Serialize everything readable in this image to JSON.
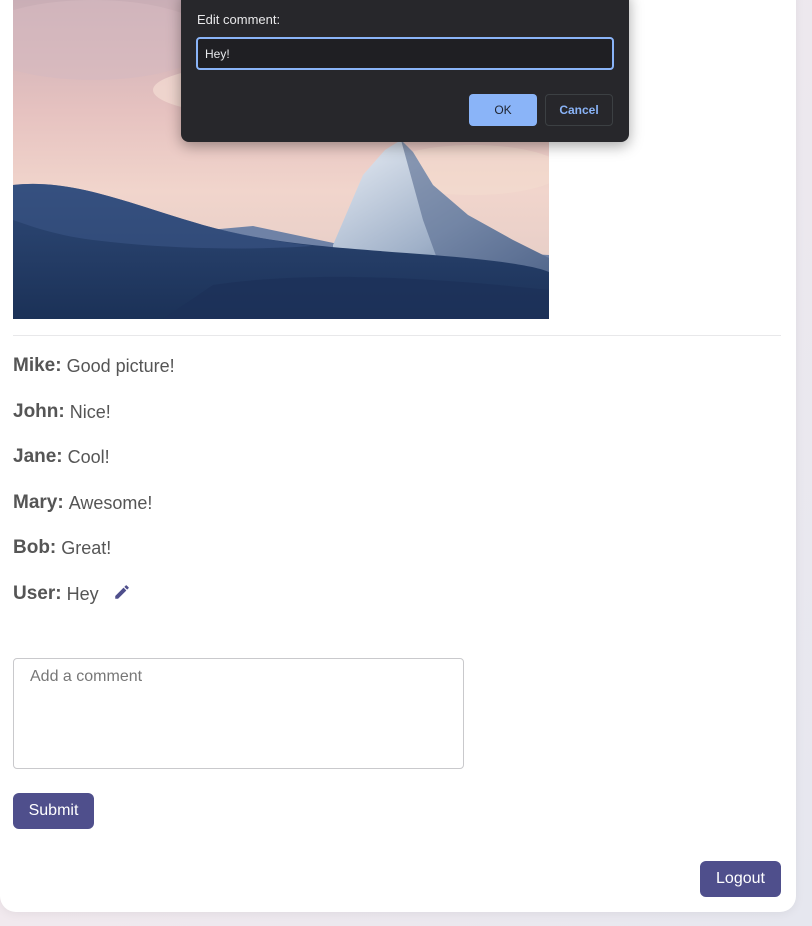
{
  "post": {
    "image_alt": "Snowy mountain peak at sunset"
  },
  "comments": [
    {
      "author": "Mike:",
      "text": "Good picture!"
    },
    {
      "author": "John:",
      "text": "Nice!"
    },
    {
      "author": "Jane:",
      "text": "Cool!"
    },
    {
      "author": "Mary:",
      "text": "Awesome!"
    },
    {
      "author": "Bob:",
      "text": "Great!"
    },
    {
      "author": "User:",
      "text": "Hey",
      "editable": true,
      "edit_icon": "pencil-icon"
    }
  ],
  "compose": {
    "placeholder": "Add a comment",
    "value": "",
    "submit_label": "Submit"
  },
  "logout_label": "Logout",
  "dialog": {
    "label": "Edit comment:",
    "input_value": "Hey!",
    "ok_label": "OK",
    "cancel_label": "Cancel"
  },
  "colors": {
    "accent": "#4f4f8c",
    "dialog_bg": "#27272b",
    "dialog_accent": "#8ab4f8"
  }
}
